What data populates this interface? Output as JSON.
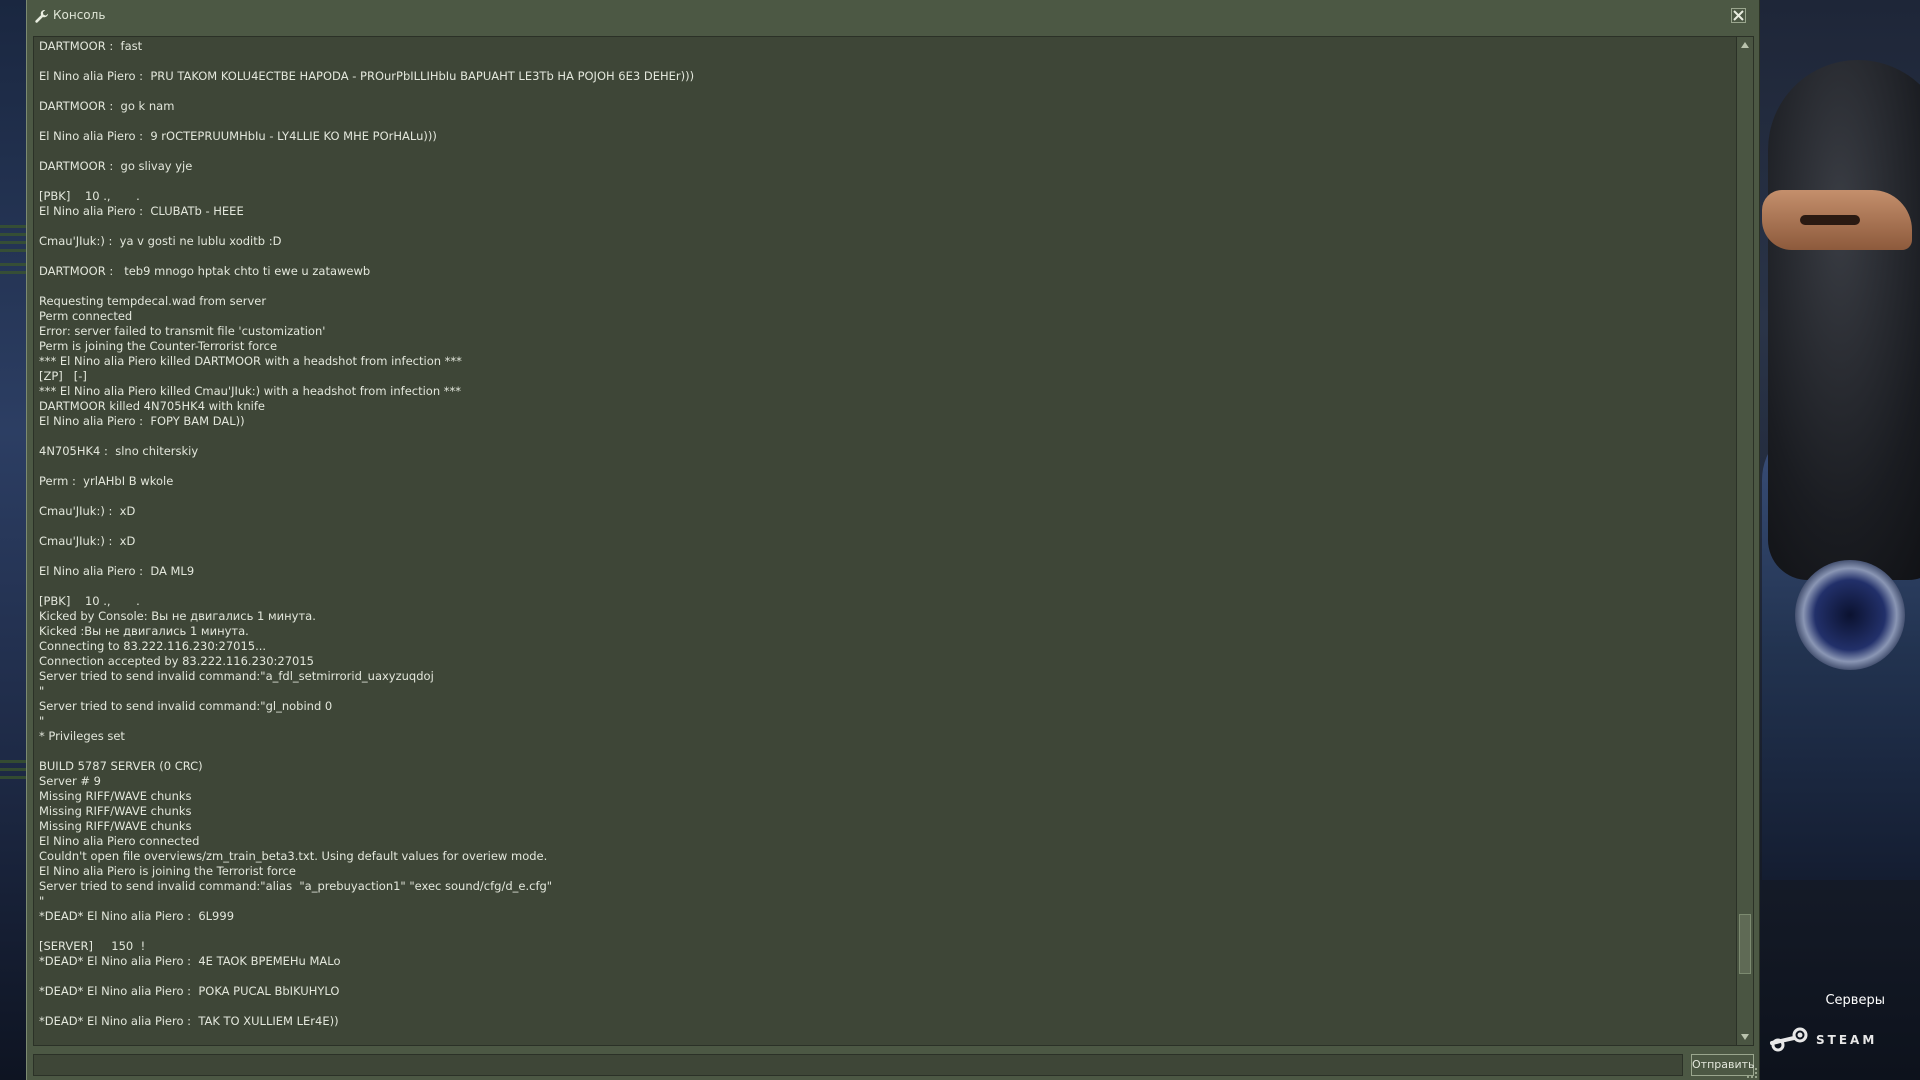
{
  "window": {
    "title": "Консоль",
    "icons": {
      "title_icon": "wrench-icon",
      "close": "close-icon"
    }
  },
  "log": [
    "DARTMOOR :  fast",
    "",
    "El Nino alia Piero :  PRU TAKOM KOLU4ECTBE HAPODA - PROurPbILLIHbIu BAPUAHT LE3Tb HA POJOH 6E3 DEHEr)))",
    "",
    "DARTMOOR :  go k nam",
    "",
    "El Nino alia Piero :  9 rOCTEPRUUMHbIu - LY4LLIE KO MHE POrHALu)))",
    "",
    "DARTMOOR :  go slivay yje",
    "",
    "[PBK]    10 .,       .",
    "El Nino alia Piero :  CLUBATb - HEEE",
    "",
    "Cmau'JIuk:) :  ya v gosti ne lublu xoditb :D",
    "",
    "DARTMOOR :   teb9 mnogo hptak chto ti ewe u zatawewb",
    "",
    "Requesting tempdecal.wad from server",
    "Perm connected",
    "Error: server failed to transmit file 'customization'",
    "Perm is joining the Counter-Terrorist force",
    "*** El Nino alia Piero killed DARTMOOR with a headshot from infection ***",
    "[ZP]   [-]",
    "*** El Nino alia Piero killed Cmau'JIuk:) with a headshot from infection ***",
    "DARTMOOR killed 4N705HK4 with knife",
    "El Nino alia Piero :  FOPY BAM DAL))",
    "",
    "4N705HK4 :  slno chiterskiy",
    "",
    "Perm :  yrlAHbI B wkole",
    "",
    "Cmau'JIuk:) :  xD",
    "",
    "Cmau'JIuk:) :  xD",
    "",
    "El Nino alia Piero :  DA ML9",
    "",
    "[PBK]    10 .,       .",
    "Kicked by Console: Вы не двигались 1 минута.",
    "Kicked :Вы не двигались 1 минута.",
    "Connecting to 83.222.116.230:27015...",
    "Connection accepted by 83.222.116.230:27015",
    "Server tried to send invalid command:\"a_fdl_setmirrorid_uaxyzuqdoj",
    "\"",
    "Server tried to send invalid command:\"gl_nobind 0",
    "\"",
    "* Privileges set",
    "",
    "BUILD 5787 SERVER (0 CRC)",
    "Server # 9",
    "Missing RIFF/WAVE chunks",
    "Missing RIFF/WAVE chunks",
    "Missing RIFF/WAVE chunks",
    "El Nino alia Piero connected",
    "Couldn't open file overviews/zm_train_beta3.txt. Using default values for overiew mode.",
    "El Nino alia Piero is joining the Terrorist force",
    "Server tried to send invalid command:\"alias  \"a_prebuyaction1\" \"exec sound/cfg/d_e.cfg\"",
    "\"",
    "*DEAD* El Nino alia Piero :  6L999",
    "",
    "[SERVER]     150  !",
    "*DEAD* El Nino alia Piero :  4E TAOK BPEMEHu MALo",
    "",
    "*DEAD* El Nino alia Piero :  POKA PUCAL BbIKUHYLO",
    "",
    "*DEAD* El Nino alia Piero :  TAK TO XULLIEM LEr4E))",
    ""
  ],
  "scrollbar": {
    "position_fraction": 0.94,
    "up_icon": "arrow-up-icon",
    "down_icon": "arrow-down-icon"
  },
  "input": {
    "value": "",
    "submit_label": "Отправить"
  },
  "overlay": {
    "servers_label": "Серверы",
    "steam_label": "STEAM",
    "steam_icon": "steam-logo-icon"
  },
  "colors": {
    "window_bg": "#4c5844",
    "log_bg": "#3e4637",
    "text": "#e3e7dc"
  }
}
